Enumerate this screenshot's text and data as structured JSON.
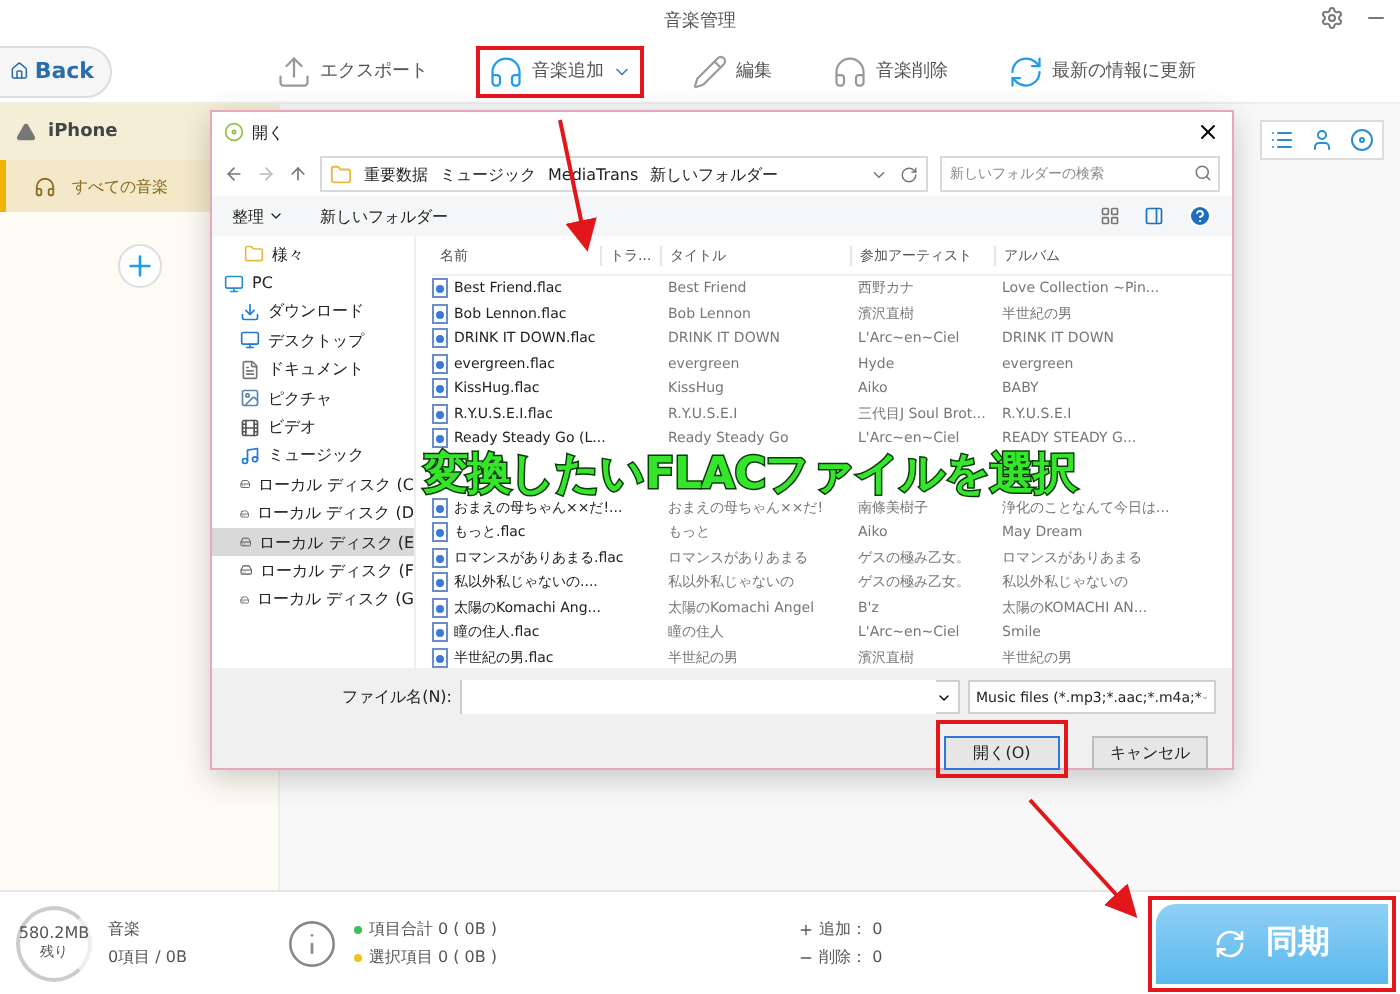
{
  "app": {
    "title": "音楽管理",
    "back": "Back"
  },
  "toolbar": [
    {
      "kind": "export",
      "label": "エクスポート",
      "highlighted": false
    },
    {
      "kind": "add",
      "label": "音楽追加",
      "highlighted": true
    },
    {
      "kind": "edit",
      "label": "編集",
      "highlighted": false
    },
    {
      "kind": "delete",
      "label": "音楽削除",
      "highlighted": false
    },
    {
      "kind": "refresh",
      "label": "最新の情報に更新",
      "highlighted": false
    }
  ],
  "sidebar": {
    "device": "iPhone",
    "items": [
      {
        "label": "すべての音楽",
        "selected": true
      }
    ]
  },
  "dialog": {
    "title": "開く",
    "breadcrumb": [
      "重要数据",
      "ミュージック",
      "MediaTrans",
      "新しいフォルダー"
    ],
    "search": {
      "placeholder": "新しいフォルダーの検索"
    },
    "commands": [
      "整理",
      "新しいフォルダー"
    ],
    "nav": [
      {
        "kind": "folder",
        "label": "様々",
        "selected": false
      },
      {
        "kind": "pc",
        "label": "PC",
        "selected": false
      },
      {
        "kind": "download",
        "label": "ダウンロード",
        "selected": false
      },
      {
        "kind": "desktop",
        "label": "デスクトップ",
        "selected": false
      },
      {
        "kind": "document",
        "label": "ドキュメント",
        "selected": false
      },
      {
        "kind": "picture",
        "label": "ピクチャ",
        "selected": false
      },
      {
        "kind": "video",
        "label": "ビデオ",
        "selected": false
      },
      {
        "kind": "music",
        "label": "ミュージック",
        "selected": false
      },
      {
        "kind": "drive",
        "label": "ローカル ディスク (C",
        "selected": false
      },
      {
        "kind": "drive",
        "label": "ローカル ディスク (D",
        "selected": false
      },
      {
        "kind": "drive",
        "label": "ローカル ディスク (E",
        "selected": true
      },
      {
        "kind": "drive",
        "label": "ローカル ディスク (F",
        "selected": false
      },
      {
        "kind": "drive",
        "label": "ローカル ディスク (G",
        "selected": false
      }
    ],
    "columns": [
      "名前",
      "トラ...",
      "タイトル",
      "参加アーティスト",
      "アルバム"
    ],
    "files": [
      {
        "name": "Best Friend.flac",
        "title": "Best Friend",
        "artist": "西野カナ",
        "album": "Love Collection ~Pin..."
      },
      {
        "name": "Bob Lennon.flac",
        "title": "Bob Lennon",
        "artist": "濱沢直樹",
        "album": "半世紀の男"
      },
      {
        "name": "DRINK IT DOWN.flac",
        "title": "DRINK IT DOWN",
        "artist": "L'Arc~en~Ciel",
        "album": "DRINK IT DOWN"
      },
      {
        "name": "evergreen.flac",
        "title": "evergreen",
        "artist": "Hyde",
        "album": "evergreen"
      },
      {
        "name": "KissHug.flac",
        "title": "KissHug",
        "artist": "Aiko",
        "album": "BABY"
      },
      {
        "name": "R.Y.U.S.E.I.flac",
        "title": "R.Y.U.S.E.I",
        "artist": "三代目J Soul Brot...",
        "album": "R.Y.U.S.E.I"
      },
      {
        "name": "Ready Steady Go (L...",
        "title": "Ready Steady Go",
        "artist": "L'Arc~en~Ciel",
        "album": "READY STEADY G..."
      },
      {
        "name": "おまえの母ちゃん××だ!...",
        "title": "おまえの母ちゃん××だ!",
        "artist": "南條美樹子",
        "album": "浄化のことなんて今日は..."
      },
      {
        "name": "もっと.flac",
        "title": "もっと",
        "artist": "Aiko",
        "album": "May Dream"
      },
      {
        "name": "ロマンスがありあまる.flac",
        "title": "ロマンスがありあまる",
        "artist": "ゲスの極み乙女。",
        "album": "ロマンスがありあまる"
      },
      {
        "name": "私以外私じゃないの....",
        "title": "私以外私じゃないの",
        "artist": "ゲスの極み乙女。",
        "album": "私以外私じゃないの"
      },
      {
        "name": "太陽のKomachi Ang...",
        "title": "太陽のKomachi Angel",
        "artist": "B'z",
        "album": "太陽のKOMACHI AN..."
      },
      {
        "name": "瞳の住人.flac",
        "title": "瞳の住人",
        "artist": "L'Arc~en~Ciel",
        "album": "Smile"
      },
      {
        "name": "半世紀の男.flac",
        "title": "半世紀の男",
        "artist": "濱沢直樹",
        "album": "半世紀の男"
      }
    ],
    "filename_label": "ファイル名(N):",
    "filetype": "Music files (*.mp3;*.aac;*.m4a;*",
    "buttons": [
      {
        "kind": "primary",
        "label": "開く(O)",
        "highlighted": true
      },
      {
        "kind": "secondary",
        "label": "キャンセル",
        "highlighted": false
      }
    ]
  },
  "caption": "変換したいFLACファイルを選択",
  "footer": {
    "capacity": "580.2MB",
    "capacity_note": "残り",
    "category": "音楽",
    "category_count": "0項目 / 0B",
    "stats": [
      {
        "label": "項目合計 0 ( 0B )",
        "color": "#3cc05a"
      },
      {
        "label": "選択項目 0 ( 0B )",
        "color": "#f2c21b"
      }
    ],
    "changes": [
      {
        "kind": "add",
        "label": "追加： 0"
      },
      {
        "kind": "remove",
        "label": "削除： 0"
      }
    ],
    "sync": {
      "label": "同期",
      "highlighted": true
    }
  }
}
